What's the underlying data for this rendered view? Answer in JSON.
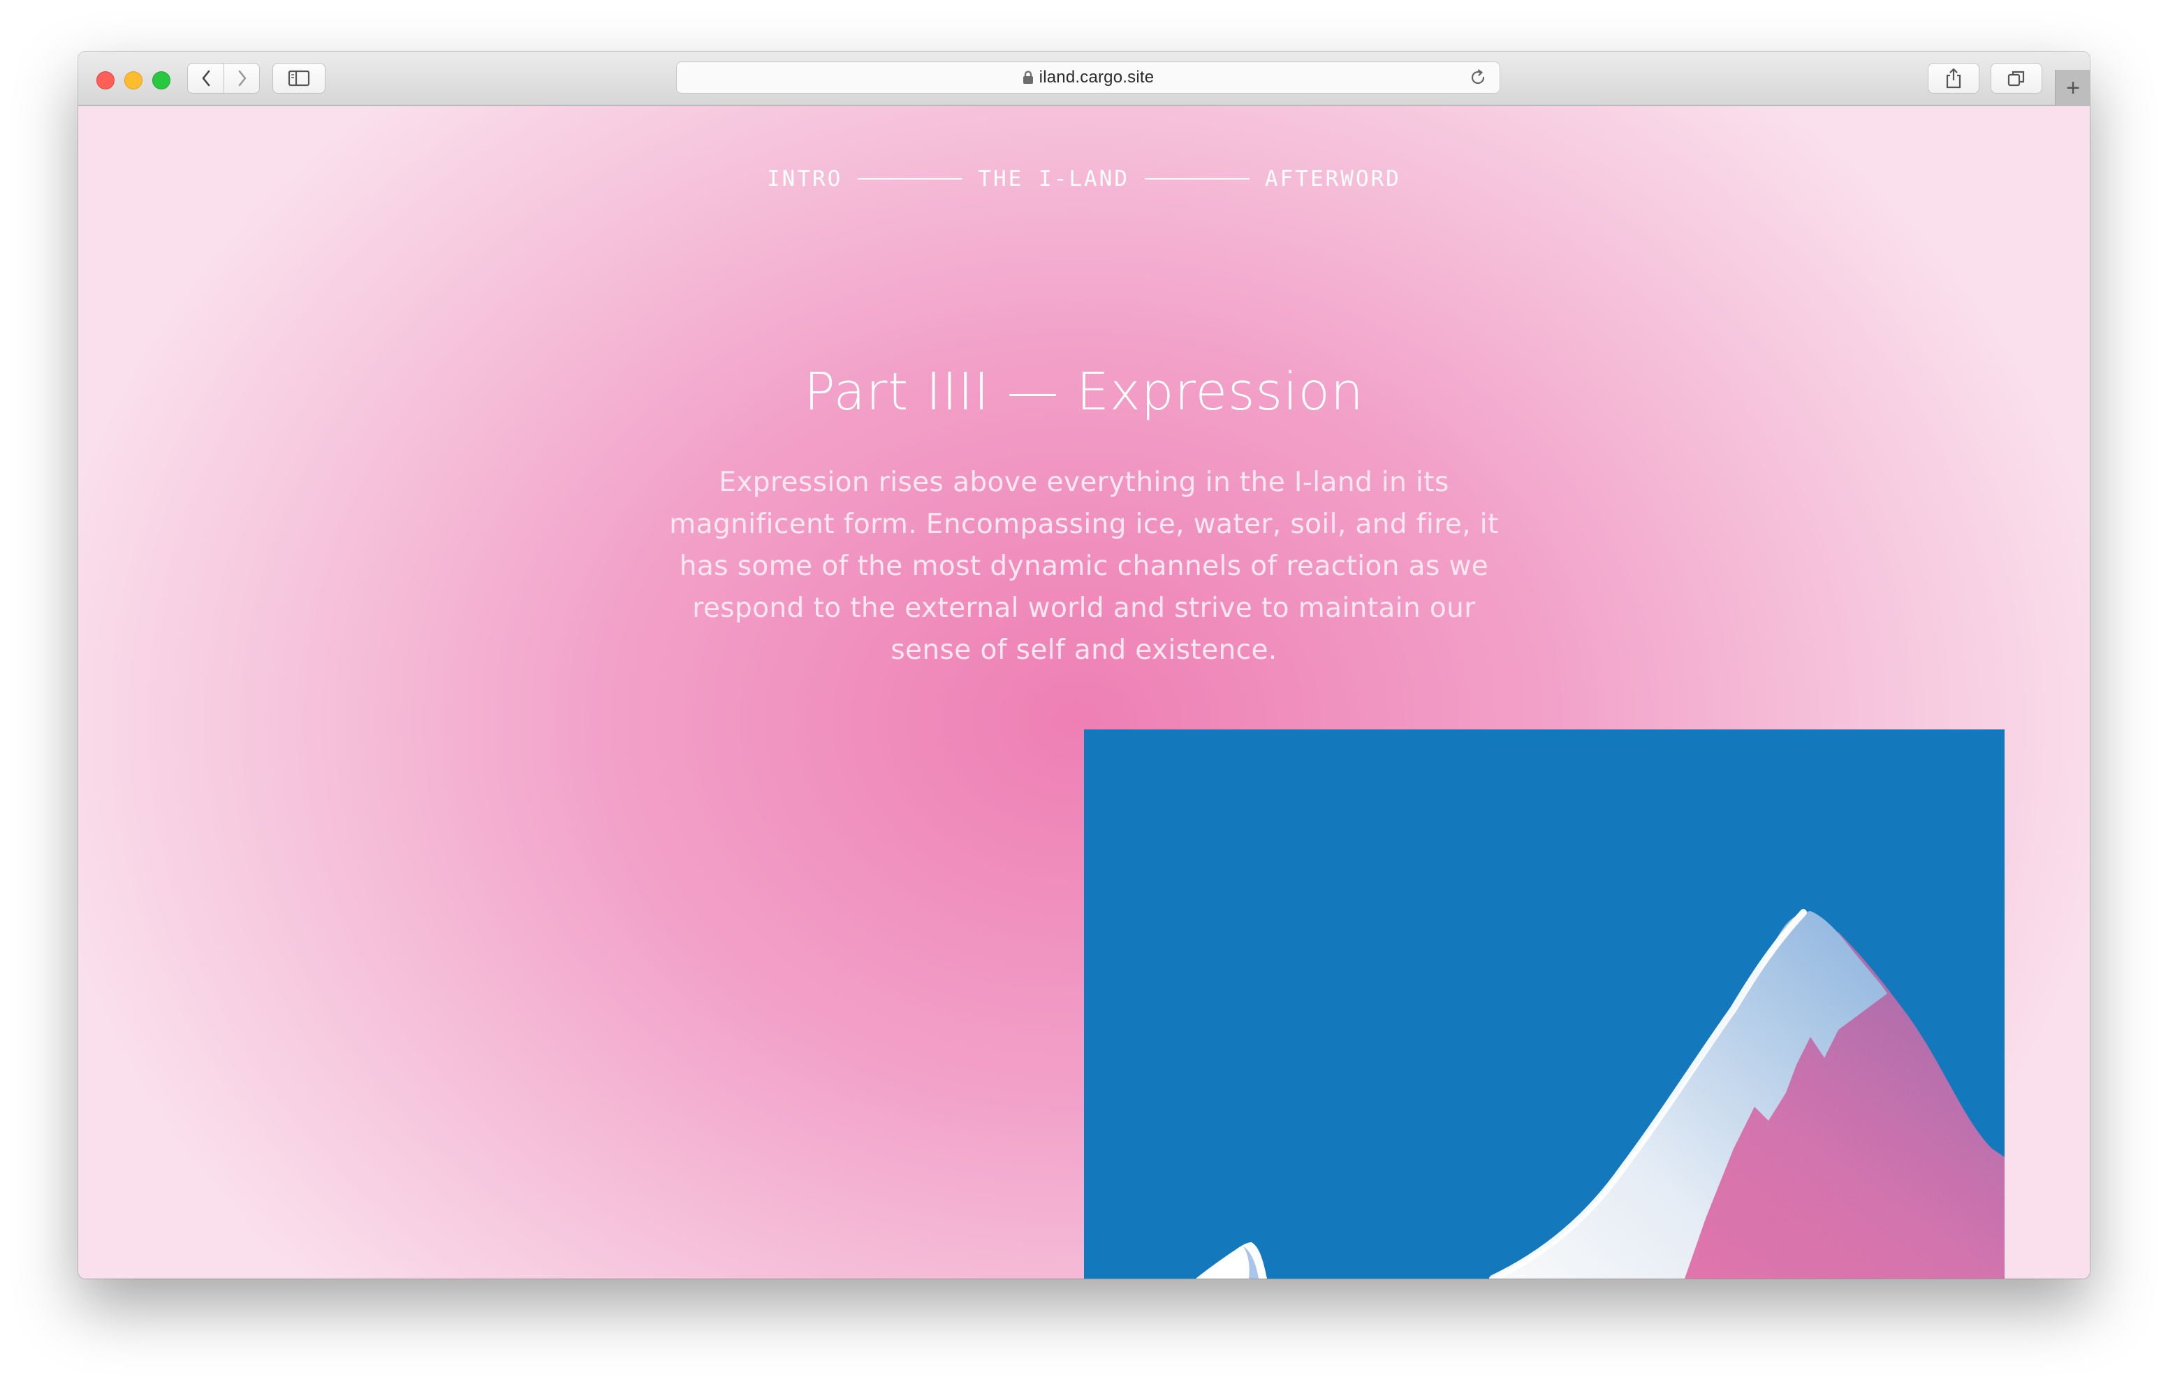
{
  "browser": {
    "url": "iland.cargo.site",
    "new_tab_label": "+"
  },
  "nav": {
    "items": [
      "INTRO",
      "THE I-LAND",
      "AFTERWORD"
    ]
  },
  "section": {
    "title": "Part IIII — Expression",
    "body": "Expression rises above everything in the I-land in its magnificent form. Encompassing ice, water, soil, and fire, it has some of the most dynamic channels of reaction as we respond to the external world and strive to maintain our sense of self and existence."
  },
  "illustration": {
    "subject": "mountain-peaks",
    "colors": {
      "sky": "#1478bd",
      "snow": "#ffffff",
      "ice": "#8fb8e3",
      "mountain_pink": "#e96ea9",
      "mountain_purple": "#9d62a8"
    }
  },
  "colors": {
    "page_center": "#ee7fb4",
    "page_edge": "#fae0ec",
    "text": "#ffffff"
  }
}
